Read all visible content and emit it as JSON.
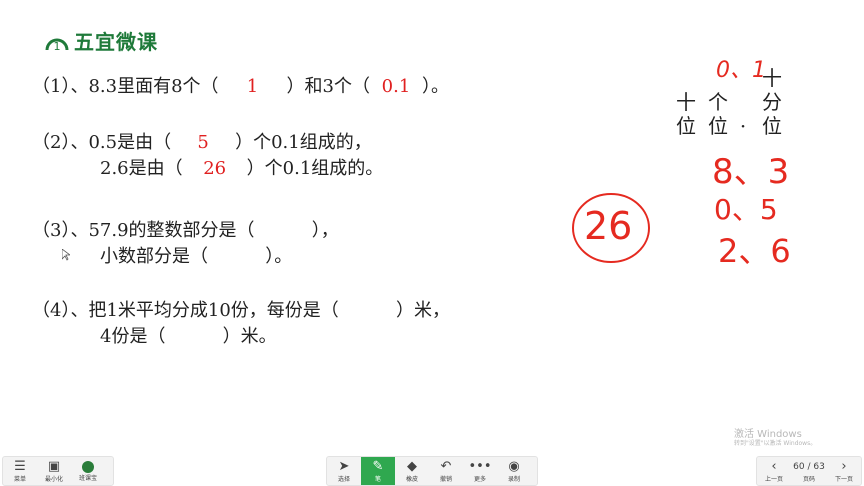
{
  "brand": {
    "name": "五宜微课",
    "logo_icon": "wuyi-logo-icon"
  },
  "questions": {
    "q1": {
      "prefix": "（1）、8.3里面有8个（",
      "blank1": "1",
      "mid": "）和3个（",
      "blank2": "0.1",
      "suffix": "）。"
    },
    "q2": {
      "line1_prefix": "（2）、0.5是由（",
      "line1_blank": "5",
      "line1_suffix": "）个0.1组成的，",
      "line2_prefix": "2.6是由（",
      "line2_blank": "26",
      "line2_suffix": "）个0.1组成的。"
    },
    "q3": {
      "line1": "（3）、57.9的整数部分是（          ），",
      "line2": "小数部分是（          ）。"
    },
    "q4": {
      "line1": "（4）、把1米平均分成10份，每份是（          ）米，",
      "line2": "4份是（          ）米。"
    }
  },
  "place_chart": {
    "tens": [
      "十",
      "位"
    ],
    "ones": [
      "个",
      "位"
    ],
    "dot": "·",
    "tenths": [
      "十",
      "分",
      "位"
    ],
    "handwritten_rows": [
      "0、1",
      "8、3",
      "0、5",
      "2、6"
    ],
    "circled": "26"
  },
  "watermark": {
    "line1": "激活 Windows",
    "line2": "转到\"设置\"以激活 Windows。"
  },
  "toolbar": {
    "left": [
      {
        "label": "菜单",
        "icon": "menu-icon"
      },
      {
        "label": "最小化",
        "icon": "minimize-icon"
      },
      {
        "label": "班课宝",
        "icon": "app-icon"
      }
    ],
    "center": [
      {
        "label": "选择",
        "icon": "cursor-icon"
      },
      {
        "label": "笔",
        "icon": "pen-icon"
      },
      {
        "label": "橡皮",
        "icon": "eraser-icon"
      },
      {
        "label": "撤销",
        "icon": "undo-icon"
      },
      {
        "label": "更多",
        "icon": "more-icon"
      },
      {
        "label": "录制",
        "icon": "record-icon"
      }
    ],
    "right": {
      "prev": "上一页",
      "page": "60 / 63",
      "page_label": "页码",
      "next": "下一页"
    }
  },
  "colors": {
    "brand": "#1f7a3a",
    "answer": "#e02020",
    "active_tool": "#2fa84f"
  }
}
